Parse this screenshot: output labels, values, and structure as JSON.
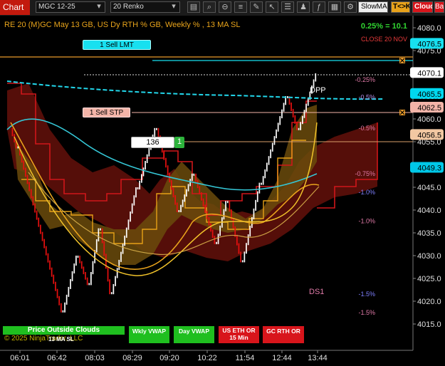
{
  "toolbar": {
    "chart_label": "Chart",
    "instrument": "MGC 12-25",
    "bar_type": "20 Renko",
    "strategy_button": "SlowMA",
    "tk_button": "T<>K",
    "cloud_button": "Cloud",
    "bar_button": "Bar",
    "icons": [
      "caret-down-icon",
      "caret-down-icon",
      "bar-chart-icon",
      "magnifier-icon",
      "magnifier-minus-icon",
      "chart-style-icon",
      "pencil-icon",
      "cursor-icon",
      "properties-icon",
      "strategies-icon",
      "indicators-icon",
      "templates-icon",
      "settings-icon",
      "cloud-icon",
      "data-box-icon",
      "wrench-icon",
      "close-icon"
    ]
  },
  "header": {
    "title": "RE 20  (M)GC May 13 GB, US Dy RTH % GB, Weekly % , 13 MA SL",
    "stat": "0.25% = 10.1",
    "close_label": "CLOSE 20 NOV"
  },
  "orders": {
    "sell_lmt": "1 Sell LMT",
    "sell_stp": "1 Sell STP",
    "pos_qty": "136",
    "pos_count": "1"
  },
  "price_axis": {
    "ticks": [
      "4080.0",
      "4075.0",
      "4070.0",
      "4065.0",
      "4060.0",
      "4055.0",
      "4050.0",
      "4045.0",
      "4040.0",
      "4035.0",
      "4030.0",
      "4025.0",
      "4020.0",
      "4015.0"
    ],
    "tags": [
      {
        "label": "4076.5",
        "price": 4076.5,
        "color": "#17e0f0"
      },
      {
        "label": "4070.1",
        "price": 4070.1,
        "color": "#ffffff"
      },
      {
        "label": "4065.5",
        "price": 4065.5,
        "color": "#00d8f0"
      },
      {
        "label": "4062.5",
        "price": 4062.5,
        "color": "#f3b4a8"
      },
      {
        "label": "4056.5",
        "price": 4056.5,
        "color": "#f2c8a2"
      },
      {
        "label": "4049.3",
        "price": 4049.3,
        "color": "#00c8e8"
      }
    ]
  },
  "time_axis": [
    "06:01",
    "06:42",
    "08:03",
    "08:29",
    "09:20",
    "10:22",
    "11:54",
    "12:44",
    "13:44"
  ],
  "levels": [
    {
      "label": "-0.25%",
      "price": 4068.6,
      "color": "#e07aa8"
    },
    {
      "label": "-0.5%",
      "price": 4064.8,
      "color": "#b98ee8"
    },
    {
      "label": "-0.5%",
      "price": 4058.0,
      "color": "#e07aa8"
    },
    {
      "label": "-0.75%",
      "price": 4048.0,
      "color": "#e07aa8"
    },
    {
      "label": "-1.0%",
      "price": 4043.9,
      "color": "#7f80ff"
    },
    {
      "label": "-1.0%",
      "price": 4037.6,
      "color": "#e07aa8"
    },
    {
      "label": "-1.5%",
      "price": 4021.6,
      "color": "#7f80ff"
    },
    {
      "label": "-1.5%",
      "price": 4017.5,
      "color": "#e07aa8"
    }
  ],
  "annotations": {
    "dpp": "DPP",
    "ds1": "DS1"
  },
  "bottom": {
    "outside_clouds": "Price Outside Clouds",
    "copyright": "© 2025 NinjaTrader, LLC",
    "ma_sl": "13 MA SL",
    "wkly_vwap": "Wkly VWAP",
    "day_vwap": "Day VWAP",
    "us_eth": "US ETH OR 15 Min",
    "gc_rth": "GC RTH OR"
  }
}
